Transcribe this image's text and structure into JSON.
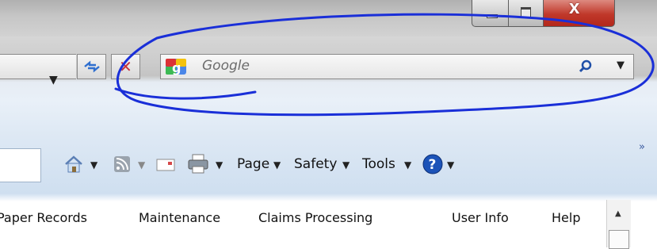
{
  "window": {
    "controls": [
      {
        "name": "minimize-icon"
      },
      {
        "name": "maximize-icon"
      },
      {
        "name": "close-icon",
        "glyph": "x"
      }
    ]
  },
  "address_bar": {
    "dropdown_glyph": "▼",
    "refresh_icon": "refresh-icon",
    "stop_icon": "stop-icon",
    "stop_glyph": "✕"
  },
  "search": {
    "placeholder": "Google",
    "provider_icon": "google-logo-icon",
    "button_icon": "search-icon",
    "dropdown_glyph": "▼"
  },
  "command_bar": {
    "items": [
      {
        "icon": "home-icon",
        "dropdown": "▼"
      },
      {
        "icon": "rss-feed-icon",
        "dropdown": "▼"
      },
      {
        "icon": "read-mail-icon"
      },
      {
        "icon": "print-icon",
        "dropdown": "▼"
      },
      {
        "label": "Page",
        "dropdown": "▼"
      },
      {
        "label": "Safety",
        "dropdown": "▼"
      },
      {
        "label": "Tools",
        "dropdown": "▼"
      },
      {
        "icon": "help-icon",
        "dropdown": "▼"
      }
    ],
    "overflow_glyph": "»"
  },
  "tabs": [
    "Paper Records",
    "Maintenance",
    "Claims Processing",
    "User Info",
    "Help"
  ],
  "scrollbar": {
    "up_glyph": "▲"
  },
  "colors": {
    "annotation": "#1a2fd8",
    "close_button": "#c0382a",
    "help_icon": "#1c53b8"
  }
}
